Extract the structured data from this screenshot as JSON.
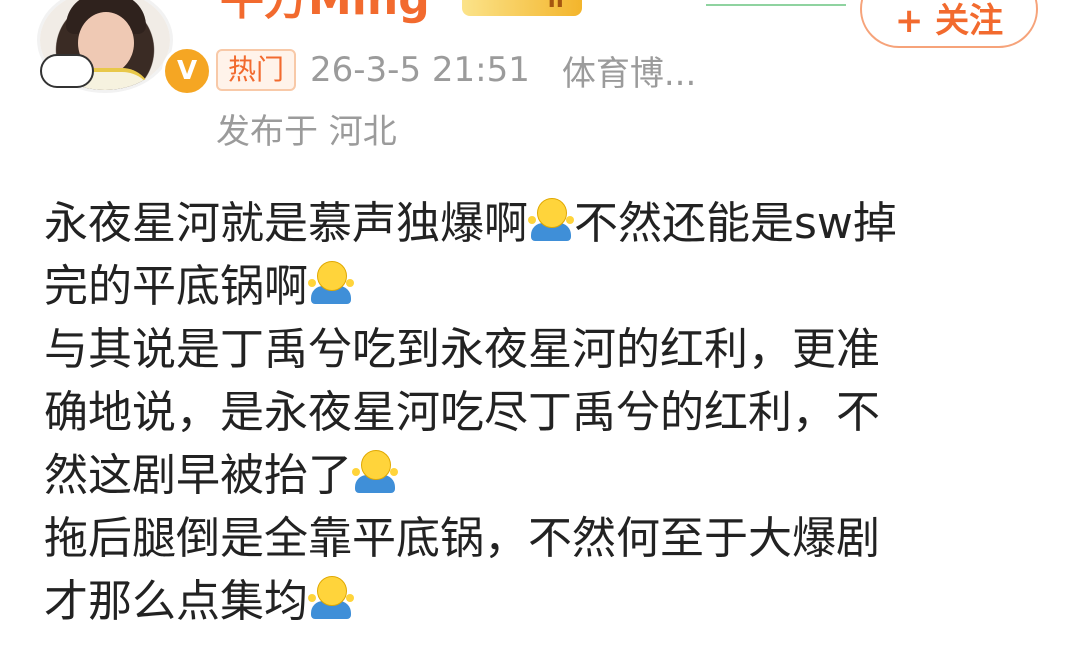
{
  "header": {
    "username": "平方Ming",
    "level": "II",
    "follow_label": "+ 关注",
    "verify_icon": "V",
    "hot_tag": "热门",
    "time": "26-3-5 21:51",
    "category": "体育博...",
    "location": "发布于 河北"
  },
  "post": {
    "lines": [
      {
        "parts": [
          "永夜星河就是慕声独爆啊",
          "不然还能是sw掉"
        ],
        "emoji_after_first": true,
        "emoji_end": false
      },
      {
        "parts": [
          "完的平底锅啊",
          ""
        ],
        "emoji_after_first": true,
        "emoji_end": false
      },
      {
        "parts": [
          "与其说是丁禹兮吃到永夜星河的红利，更准",
          ""
        ],
        "emoji_after_first": false,
        "emoji_end": false
      },
      {
        "parts": [
          "确地说，是永夜星河吃尽丁禹兮的红利，不",
          ""
        ],
        "emoji_after_first": false,
        "emoji_end": false
      },
      {
        "parts": [
          "然这剧早被抬了",
          ""
        ],
        "emoji_after_first": true,
        "emoji_end": false
      },
      {
        "parts": [
          "拖后腿倒是全靠平底锅，不然何至于大爆剧",
          ""
        ],
        "emoji_after_first": false,
        "emoji_end": false
      },
      {
        "parts": [
          "才那么点集均",
          ""
        ],
        "emoji_after_first": true,
        "emoji_end": false
      }
    ],
    "emoji_name": "shrug-emoji"
  },
  "colors": {
    "accent": "#f26a2e",
    "meta": "#9b9b9b",
    "text": "#222222"
  }
}
